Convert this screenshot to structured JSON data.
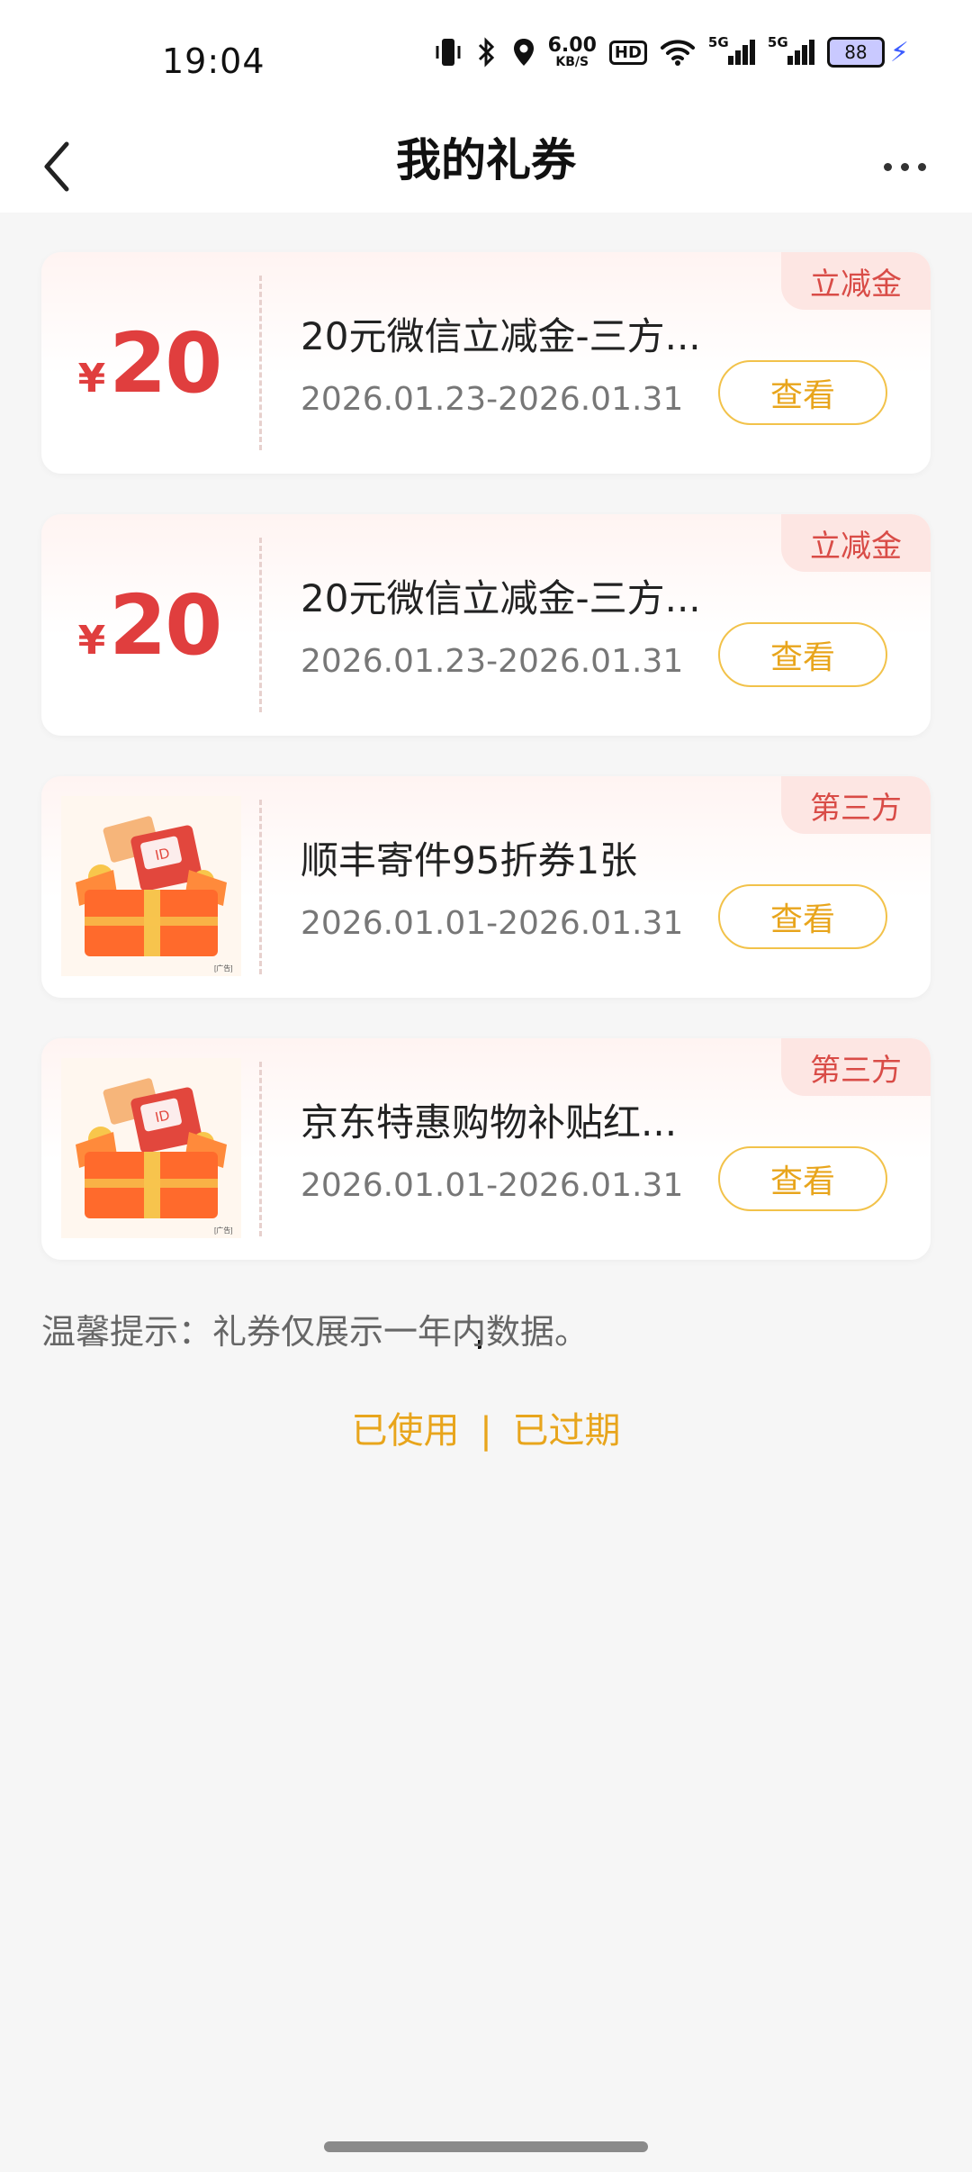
{
  "status_bar": {
    "time": "19:04",
    "speed_value": "6.00",
    "speed_unit": "KB/S",
    "hd": "HD",
    "net1": "5G",
    "net2": "5G",
    "battery": "88"
  },
  "header": {
    "title": "我的礼券"
  },
  "coupons": [
    {
      "type": "amount",
      "currency": "¥",
      "amount": "20",
      "name": "20元微信立减金-三方...",
      "date": "2026.01.23-2026.01.31",
      "tag": "立减金",
      "button": "查看"
    },
    {
      "type": "amount",
      "currency": "¥",
      "amount": "20",
      "name": "20元微信立减金-三方...",
      "date": "2026.01.23-2026.01.31",
      "tag": "立减金",
      "button": "查看"
    },
    {
      "type": "image",
      "name": "顺丰寄件95折券1张",
      "date": "2026.01.01-2026.01.31",
      "tag": "第三方",
      "button": "查看"
    },
    {
      "type": "image",
      "name": "京东特惠购物补贴红...",
      "date": "2026.01.01-2026.01.31",
      "tag": "第三方",
      "button": "查看"
    }
  ],
  "tip": "温馨提示：礼券仅展示一年内数据。",
  "links": {
    "used": "已使用",
    "separator": "|",
    "expired": "已过期"
  },
  "colors": {
    "accent_red": "#e03e3e",
    "accent_gold": "#e8a51c",
    "background": "#f6f6f6"
  },
  "icons": {
    "back": "chevron-left-icon",
    "more": "more-dots-icon",
    "gift": "gift-box-image"
  }
}
